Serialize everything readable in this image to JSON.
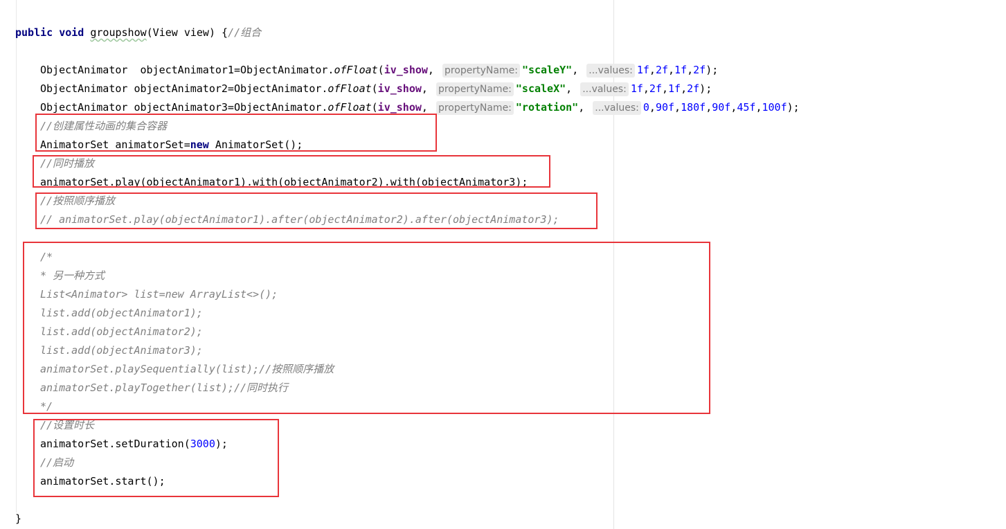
{
  "code": {
    "sig_public": "public",
    "sig_void": "void",
    "sig_method": "groupshow",
    "sig_params": "(View view) {",
    "sig_comment": "//组合",
    "anim1": {
      "type": "ObjectAnimator  objectAnimator1=ObjectAnimator.",
      "method": "ofFloat",
      "open": "(",
      "target": "iv_show",
      "comma": ", ",
      "hint_prop": "propertyName:",
      "prop": "\"scaleY\"",
      "comma2": ", ",
      "hint_values": "...values:",
      "values": [
        "1f",
        "2f",
        "1f",
        "2f"
      ],
      "close": ");"
    },
    "anim2": {
      "type": "ObjectAnimator objectAnimator2=ObjectAnimator.",
      "method": "ofFloat",
      "open": "(",
      "target": "iv_show",
      "comma": ", ",
      "hint_prop": "propertyName:",
      "prop": "\"scaleX\"",
      "comma2": ", ",
      "hint_values": "...values:",
      "values": [
        "1f",
        "2f",
        "1f",
        "2f"
      ],
      "close": ");"
    },
    "anim3": {
      "type": "ObjectAnimator objectAnimator3=ObjectAnimator.",
      "method": "ofFloat",
      "open": "(",
      "target": "iv_show",
      "comma": ", ",
      "hint_prop": "propertyName:",
      "prop": "\"rotation\"",
      "comma2": ", ",
      "hint_values": "...values:",
      "values": [
        "0",
        "90f",
        "180f",
        "90f",
        "45f",
        "100f"
      ],
      "close": ");"
    },
    "comment_create": "//创建属性动画的集合容器",
    "set_decl_a": "AnimatorSet animatorSet=",
    "set_decl_new": "new",
    "set_decl_b": " AnimatorSet();",
    "comment_together": "//同时播放",
    "play_with": "animatorSet.play(objectAnimator1).with(objectAnimator2).with(objectAnimator3);",
    "comment_sequence": "//按照顺序播放",
    "play_after_commented": "// animatorSet.play(objectAnimator1).after(objectAnimator2).after(objectAnimator3);",
    "block_comment": [
      "/*",
      "* 另一种方式",
      "List<Animator> list=new ArrayList<>();",
      "list.add(objectAnimator1);",
      "list.add(objectAnimator2);",
      "list.add(objectAnimator3);",
      "animatorSet.playSequentially(list);//按照顺序播放",
      "animatorSet.playTogether(list);//同时执行",
      "*/"
    ],
    "comment_duration": "//设置时长",
    "duration_a": "animatorSet.setDuration(",
    "duration_value": "3000",
    "duration_b": ");",
    "comment_start": "//启动",
    "start_call": "animatorSet.start();",
    "closing_brace": "}"
  },
  "colors": {
    "keyword": "#000080",
    "comment": "#808080",
    "field": "#660e7a",
    "string": "#008000",
    "number": "#0000ff",
    "highlight_box": "#e8343a"
  }
}
